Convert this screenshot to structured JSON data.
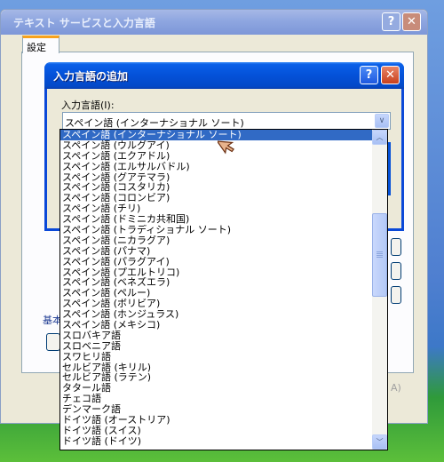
{
  "outer_dialog": {
    "title": "テキスト サービスと入力言語",
    "help_glyph": "?",
    "close_glyph": "✕",
    "tab_label": "設定",
    "group_label": "基本",
    "apply_label": "A)"
  },
  "add_dialog": {
    "title": "入力言語の追加",
    "help_glyph": "?",
    "close_glyph": "✕",
    "field_label": "入力言語(I):",
    "combo_value": "スペイン語 (インターナショナル ソート)",
    "combo_arrow": "∨"
  },
  "language_list": {
    "selected_index": 0,
    "items": [
      "スペイン語 (インターナショナル ソート)",
      "スペイン語 (ウルグアイ)",
      "スペイン語 (エクアドル)",
      "スペイン語 (エルサルバドル)",
      "スペイン語 (グアテマラ)",
      "スペイン語 (コスタリカ)",
      "スペイン語 (コロンビア)",
      "スペイン語 (チリ)",
      "スペイン語 (ドミニカ共和国)",
      "スペイン語 (トラディショナル ソート)",
      "スペイン語 (ニカラグア)",
      "スペイン語 (パナマ)",
      "スペイン語 (パラグアイ)",
      "スペイン語 (プエルトリコ)",
      "スペイン語 (ベネズエラ)",
      "スペイン語 (ペルー)",
      "スペイン語 (ボリビア)",
      "スペイン語 (ホンジュラス)",
      "スペイン語 (メキシコ)",
      "スロバキア語",
      "スロベニア語",
      "スワヒリ語",
      "セルビア語 (キリル)",
      "セルビア語 (ラテン)",
      "タタール語",
      "チェコ語",
      "デンマーク語",
      "ドイツ語 (オーストリア)",
      "ドイツ語 (スイス)",
      "ドイツ語 (ドイツ)"
    ],
    "scroll_up_glyph": "︿",
    "scroll_down_glyph": "﹀"
  },
  "icons": {
    "cursor": "pointer-arrow-icon",
    "combo_arrow": "chevron-down-icon",
    "scroll_up": "chevron-up-icon",
    "scroll_down": "chevron-down-icon"
  },
  "colors": {
    "titlebar_active": "#0451d8",
    "titlebar_inactive": "#8ea6e0",
    "selection": "#316ac5",
    "dialog_face": "#ece9d8"
  }
}
